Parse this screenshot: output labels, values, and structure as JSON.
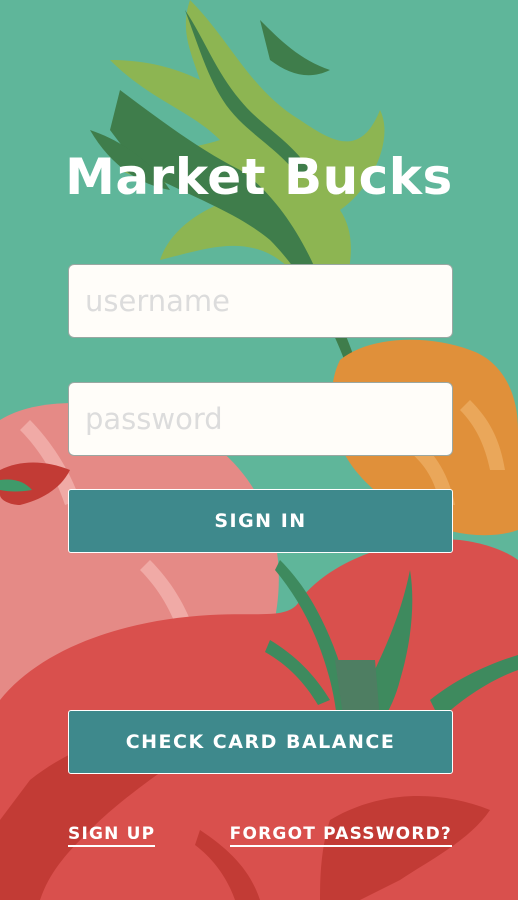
{
  "app": {
    "title": "Market Bucks"
  },
  "login": {
    "username_placeholder": "username",
    "password_placeholder": "password",
    "signin_label": "SIGN IN"
  },
  "actions": {
    "check_balance_label": "CHECK CARD BALANCE"
  },
  "footer": {
    "signup_label": "SIGN UP",
    "forgot_label": "FORGOT PASSWORD?"
  },
  "colors": {
    "background": "#5fb69a",
    "button": "#3e898c",
    "text": "#ffffff",
    "field_bg": "#fffdf9",
    "carrot": "#e0903a",
    "tomato": "#d9504d",
    "radish": "#e58a86",
    "greens": "#8db552"
  },
  "background_art": [
    "carrot-greens",
    "carrot",
    "radish",
    "tomato"
  ]
}
